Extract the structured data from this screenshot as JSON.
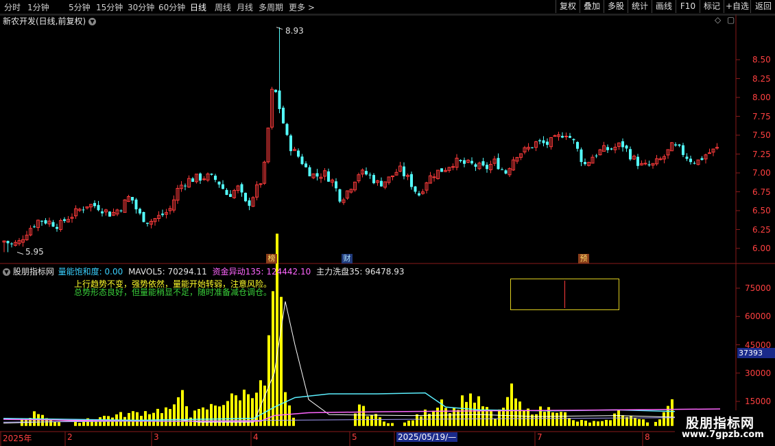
{
  "toolbar": {
    "timeframes": [
      "分时",
      "1分钟",
      "5分钟",
      "15分钟",
      "30分钟",
      "60分钟",
      "日线",
      "周线",
      "月线",
      "多周期",
      "更多 >"
    ],
    "active": "日线",
    "right_buttons": [
      "复权",
      "叠加",
      "多股",
      "统计",
      "画线",
      "F10",
      "标记",
      "+自选",
      "返回"
    ]
  },
  "price_panel": {
    "title": "新农开发(日线,前复权)",
    "high_label": "8.93",
    "low_label": "5.95",
    "markers": [
      "榜",
      "财",
      "预"
    ],
    "y_ticks": [
      "8.50",
      "8.25",
      "8.00",
      "7.75",
      "7.50",
      "7.25",
      "7.00",
      "6.75",
      "6.50",
      "6.25",
      "6.00"
    ]
  },
  "indicator_panel": {
    "name": "股朋指标网",
    "values": [
      {
        "label": "量能饱和度: 0.00",
        "color": "#3ad1ff"
      },
      {
        "label": "MAVOL5: 70294.11",
        "color": "#e6e6e6"
      },
      {
        "label": "资金异动135: 124442.10",
        "color": "#ff66ff"
      },
      {
        "label": "主力洗盘35: 96478.93",
        "color": "#e6e6e6"
      }
    ],
    "text_line1": "上行趋势不变，强势依然，量能开始转弱，注意风险。",
    "text_line2": "总势形态良好，但量能稍显不足，随时准备减仓调仓。",
    "y_ticks": [
      "75000",
      "60000",
      "45000",
      "30000",
      "15000"
    ],
    "highlight_value": "37393"
  },
  "x_axis": {
    "labels": [
      "2025年",
      "2",
      "3",
      "4",
      "5",
      "2025/05/19/—",
      "7",
      "8"
    ]
  },
  "watermark": {
    "line1": "股朋指标网",
    "line2": "www.7gpzb.com"
  },
  "colors": {
    "up": "#ff3b3b",
    "down": "#54ffff",
    "volume": "#ffff00",
    "line_white": "#ffffff",
    "line_cyan": "#5cf0ff",
    "line_magenta": "#ff66ff",
    "line_lavender": "#a8a0ff",
    "axis": "#8a1a1a"
  }
}
